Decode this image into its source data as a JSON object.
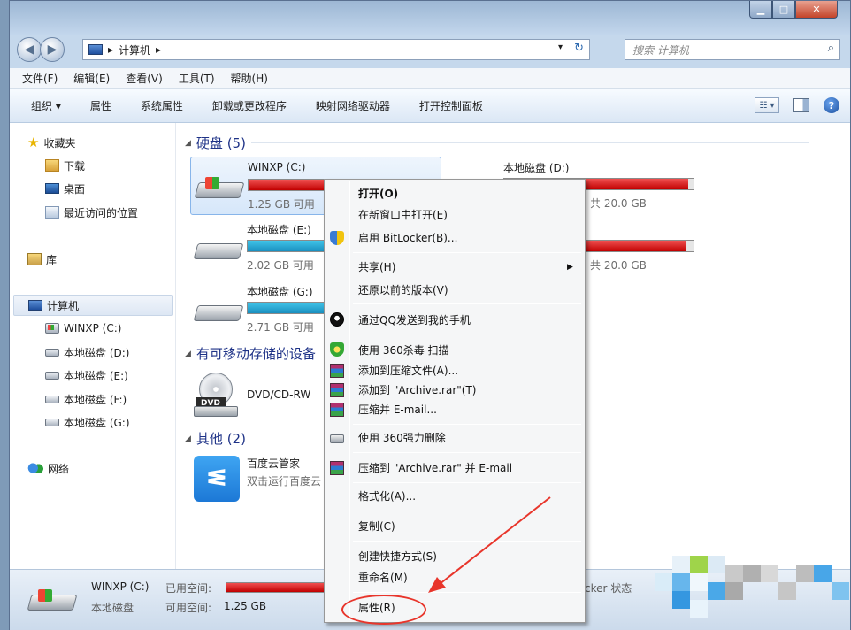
{
  "window": {
    "address_path": "计算机",
    "search_placeholder": "搜索 计算机"
  },
  "menubar": [
    "文件(F)",
    "编辑(E)",
    "查看(V)",
    "工具(T)",
    "帮助(H)"
  ],
  "toolbar": [
    "组织 ▾",
    "属性",
    "系统属性",
    "卸载或更改程序",
    "映射网络驱动器",
    "打开控制面板"
  ],
  "sidebar": {
    "favorites": "收藏夹",
    "downloads": "下载",
    "desktop": "桌面",
    "recent": "最近访问的位置",
    "libraries": "库",
    "computer": "计算机",
    "drive_c": "WINXP (C:)",
    "drive_d": "本地磁盘 (D:)",
    "drive_e": "本地磁盘 (E:)",
    "drive_f": "本地磁盘 (F:)",
    "drive_g": "本地磁盘 (G:)",
    "network": "网络"
  },
  "groups": {
    "hdd": "硬盘 (5)",
    "removable": "有可移动存储的设备",
    "other": "其他 (2)"
  },
  "drives": [
    {
      "name": "WINXP (C:)",
      "free": "1.25 GB 可用",
      "used_fraction": 0.96,
      "color": "red"
    },
    {
      "name": "本地磁盘 (D:)",
      "free": "共 20.0 GB",
      "used_fraction": 0.97,
      "color": "red"
    },
    {
      "name": "本地磁盘 (E:)",
      "free": "2.02 GB 可用",
      "used_fraction": 0.93,
      "color": "blue"
    },
    {
      "name": "",
      "free": "共 20.0 GB",
      "used_fraction": 0.96,
      "color": "red"
    },
    {
      "name": "本地磁盘 (G:)",
      "free": "2.71 GB 可用",
      "used_fraction": 0.9,
      "color": "blue"
    }
  ],
  "devices": {
    "dvd": "DVD/CD-RW",
    "dvd_label": "DVD",
    "baidu_name": "百度云管家",
    "baidu_desc": "双击运行百度云"
  },
  "context_menu": {
    "open": "打开(O)",
    "open_new": "在新窗口中打开(E)",
    "bitlocker": "启用 BitLocker(B)...",
    "share": "共享(H)",
    "restore": "还原以前的版本(V)",
    "qq": "通过QQ发送到我的手机",
    "scan360": "使用 360杀毒 扫描",
    "add_archive": "添加到压缩文件(A)...",
    "add_rar": "添加到 \"Archive.rar\"(T)",
    "compress_email": "压缩并 E-mail...",
    "delete360": "使用 360强力删除",
    "compress_rar_email": "压缩到 \"Archive.rar\" 并 E-mail",
    "format": "格式化(A)...",
    "copy": "复制(C)",
    "shortcut": "创建快捷方式(S)",
    "rename": "重命名(M)",
    "properties": "属性(R)"
  },
  "statusbar": {
    "name": "WINXP (C:)",
    "used_label": "已用空间:",
    "type": "本地磁盘",
    "free_label": "可用空间:",
    "free_value": "1.25 GB",
    "bitlocker_status": "cker 状态"
  },
  "colors": {
    "annotation_red": "#e8352b",
    "usage_red": "#c10000",
    "usage_blue": "#1a8fbf"
  }
}
